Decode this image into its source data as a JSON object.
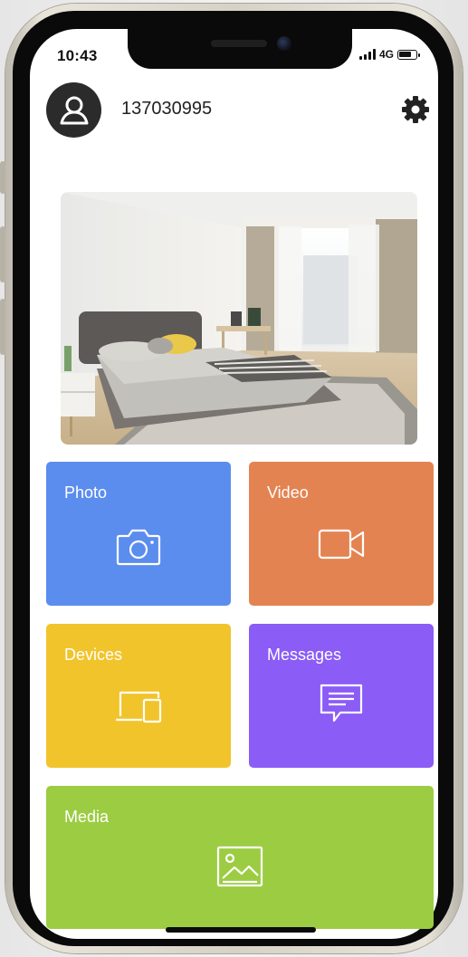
{
  "status_bar": {
    "time": "10:43",
    "network": "4G"
  },
  "header": {
    "user_id": "137030995",
    "avatar_icon": "user-icon",
    "settings_icon": "gear-icon"
  },
  "preview": {
    "image_description_icon": "camera-preview"
  },
  "tiles": [
    {
      "label": "Photo",
      "icon": "camera-icon",
      "color": "#5b8dee"
    },
    {
      "label": "Video",
      "icon": "video-camera-icon",
      "color": "#e48352"
    },
    {
      "label": "Devices",
      "icon": "devices-icon",
      "color": "#f2c42c"
    },
    {
      "label": "Messages",
      "icon": "message-icon",
      "color": "#8b5cf6"
    },
    {
      "label": "Media",
      "icon": "image-icon",
      "color": "#9ccc42"
    }
  ]
}
